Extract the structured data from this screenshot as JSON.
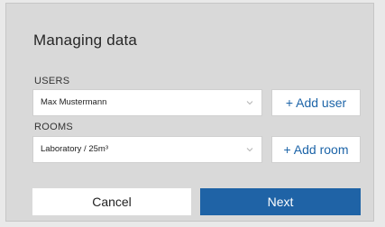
{
  "dialog": {
    "title": "Managing data"
  },
  "users": {
    "label": "USERS",
    "selected": "Max Mustermann",
    "add_label": "+ Add user"
  },
  "rooms": {
    "label": "ROOMS",
    "selected": "Laboratory / 25m³",
    "add_label": "+ Add room"
  },
  "actions": {
    "cancel_label": "Cancel",
    "next_label": "Next"
  },
  "colors": {
    "accent": "#1f63a6",
    "link": "#1c64a8",
    "dialog_bg": "#d9d9d9"
  },
  "icons": {
    "dropdown": "chevron-down-icon"
  }
}
